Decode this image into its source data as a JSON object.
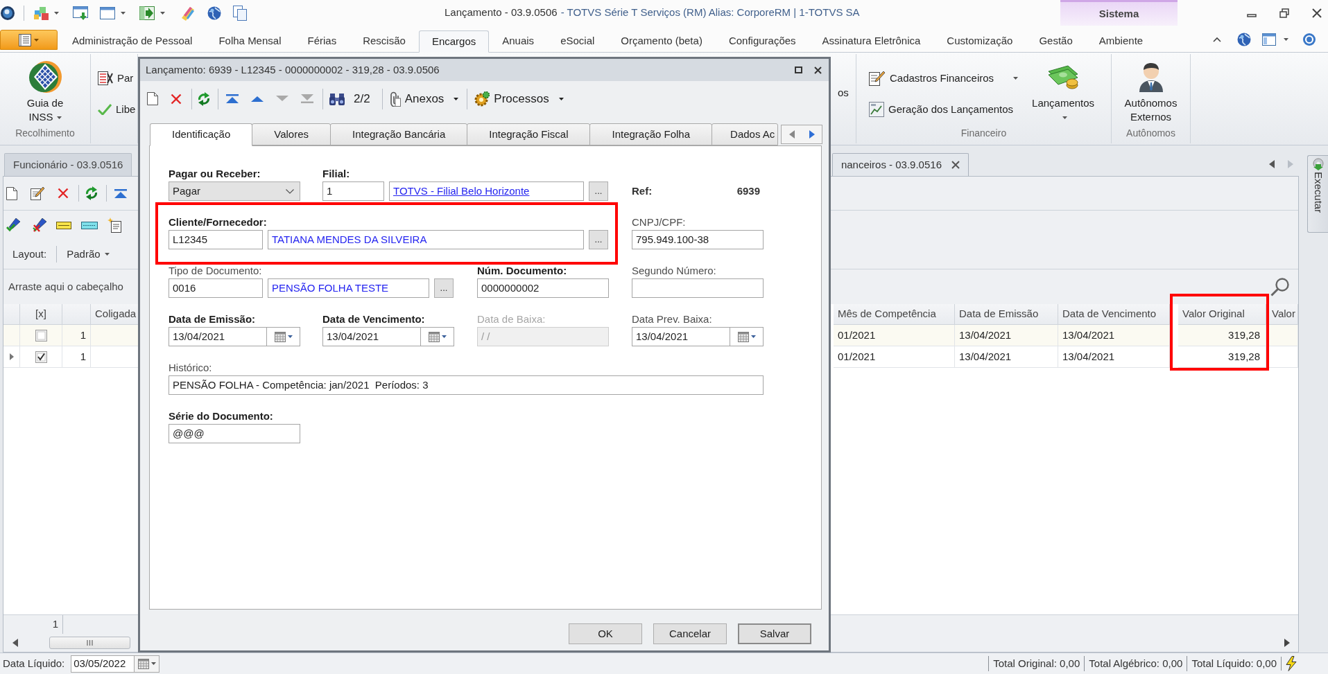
{
  "window": {
    "title": "Lançamento - 03.9.0506",
    "app_info": "- TOTVS Série T Serviços (RM) Alias: CorporeRM | 1-TOTVS SA",
    "context_tab": "Sistema"
  },
  "ribbon": {
    "tabs": [
      {
        "label": "Administração de Pessoal",
        "selected": false
      },
      {
        "label": "Folha Mensal",
        "selected": false
      },
      {
        "label": "Férias",
        "selected": false
      },
      {
        "label": "Rescisão",
        "selected": false
      },
      {
        "label": "Encargos",
        "selected": true
      },
      {
        "label": "Anuais",
        "selected": false
      },
      {
        "label": "eSocial",
        "selected": false
      },
      {
        "label": "Orçamento (beta)",
        "selected": false
      },
      {
        "label": "Configurações",
        "selected": false
      },
      {
        "label": "Assinatura Eletrônica",
        "selected": false
      },
      {
        "label": "Customização",
        "selected": false
      },
      {
        "label": "Gestão",
        "selected": false
      },
      {
        "label": "Ambiente",
        "selected": false
      }
    ],
    "groups_left": [
      {
        "label": "Recolhimento",
        "buttons": [
          {
            "kind": "large",
            "label": "Guia de INSS",
            "dropdown": true
          }
        ]
      },
      {
        "buttons": [
          {
            "kind": "small",
            "label": "Par"
          },
          {
            "kind": "small",
            "label": "Libe"
          }
        ]
      }
    ],
    "groups_right": [
      {
        "buttons": [
          {
            "kind": "fragment",
            "label": "os"
          }
        ]
      },
      {
        "label": "Financeiro",
        "buttons": [
          {
            "kind": "small",
            "label": "Cadastros Financeiros",
            "dropdown": true
          },
          {
            "kind": "small",
            "label": "Geração dos Lançamentos",
            "dropdown": false
          },
          {
            "kind": "large",
            "label": "Lançamentos",
            "dropdown": true
          }
        ]
      },
      {
        "label": "Autônomos",
        "buttons": [
          {
            "kind": "large",
            "label": "Autônomos Externos",
            "dropdown": false
          }
        ]
      }
    ]
  },
  "doc_tabs": [
    {
      "label": "Funcionário - 03.9.0516",
      "selected": false
    },
    {
      "label": "nanceiros - 03.9.0516",
      "selected": true
    }
  ],
  "list": {
    "layout_label": "Layout:",
    "layout_value": "Padrão",
    "group_hint": "Arraste aqui o cabeçalho",
    "columns_left": [
      {
        "label": "[x]"
      },
      {
        "label": "Coligada"
      }
    ],
    "columns_right": [
      {
        "label": "Mês de Competência",
        "kind": "text",
        "highlighted": false
      },
      {
        "label": "Data de Emissão",
        "kind": "text",
        "highlighted": false
      },
      {
        "label": "Data de Vencimento",
        "kind": "text",
        "highlighted": false
      },
      {
        "label": "Valor Original",
        "kind": "number",
        "highlighted": true
      },
      {
        "label": "Valor",
        "kind": "number",
        "highlighted": false
      }
    ],
    "rows": [
      {
        "selected": false,
        "checked": false,
        "column_3": "1",
        "cells": [
          "01/2021",
          "13/04/2021",
          "13/04/2021",
          "319,28"
        ]
      },
      {
        "selected": true,
        "checked": true,
        "column_3": "1",
        "cells": [
          "01/2021",
          "13/04/2021",
          "13/04/2021",
          "319,28"
        ]
      }
    ],
    "footer_count": "1"
  },
  "side_panel": {
    "label": "Executar"
  },
  "status_bar": {
    "label": "Data Líquido:",
    "value": "03/05/2022",
    "totals": [
      "Total Original: 0,00",
      "Total Algébrico: 0,00",
      "Total Líquido: 0,00"
    ]
  },
  "dialog": {
    "title": "Lançamento: 6939 - L12345 - 0000000002 - 319,28 - 03.9.0506",
    "toolbar": {
      "nav": [
        {
          "disabled": false
        },
        {
          "disabled": false
        },
        {
          "disabled": true
        },
        {
          "disabled": true
        }
      ],
      "counter": "2/2",
      "menus": [
        {
          "label": "Anexos"
        },
        {
          "label": "Processos"
        }
      ]
    },
    "tabs": [
      {
        "label": "Identificação",
        "selected": true
      },
      {
        "label": "Valores",
        "selected": false
      },
      {
        "label": "Integração Bancária",
        "selected": false
      },
      {
        "label": "Integração Fiscal",
        "selected": false
      },
      {
        "label": "Integração Folha",
        "selected": false
      },
      {
        "label": "Dados Ac",
        "selected": false
      }
    ],
    "form": [
      [
        {
          "kind": "select",
          "label": "Pagar ou Receber:",
          "required": true,
          "disabled": false,
          "highlighted": false,
          "value": "Pagar"
        },
        {
          "kind": "lookup",
          "label": "Filial:",
          "required": true,
          "disabled": false,
          "highlighted": false,
          "code": "1",
          "description": "TOTVS - Filial Belo Horizonte",
          "link": true,
          "button": "..."
        },
        {
          "kind": "readonly",
          "label": "Ref:",
          "value": "6939"
        }
      ],
      [
        {
          "kind": "lookup",
          "label": "Cliente/Fornecedor:",
          "required": true,
          "disabled": false,
          "highlighted": true,
          "code": "L12345",
          "description": "TATIANA MENDES DA SILVEIRA",
          "link": false,
          "button": "..."
        },
        {
          "kind": "text",
          "label": "CNPJ/CPF:",
          "required": false,
          "disabled": false,
          "highlighted": false,
          "value": "795.949.100-38"
        }
      ],
      [
        {
          "kind": "lookup",
          "label": "Tipo de Documento:",
          "required": false,
          "disabled": false,
          "highlighted": false,
          "code": "0016",
          "description": "PENSÃO FOLHA TESTE",
          "link": false,
          "button": "..."
        },
        {
          "kind": "text",
          "label": "Núm. Documento:",
          "required": true,
          "disabled": false,
          "highlighted": false,
          "value": "0000000002"
        },
        {
          "kind": "text",
          "label": "Segundo Número:",
          "required": false,
          "disabled": false,
          "highlighted": false
        }
      ],
      [
        {
          "kind": "date",
          "label": "Data de Emissão:",
          "required": true,
          "disabled": false,
          "highlighted": false,
          "value": "13/04/2021"
        },
        {
          "kind": "date",
          "label": "Data de Vencimento:",
          "required": true,
          "disabled": false,
          "highlighted": false,
          "value": "13/04/2021"
        },
        {
          "kind": "text",
          "label": "Data de Baixa:",
          "required": false,
          "disabled": true,
          "highlighted": false,
          "value": "/ /"
        },
        {
          "kind": "date",
          "label": "Data Prev. Baixa:",
          "required": false,
          "disabled": false,
          "highlighted": false,
          "value": "13/04/2021"
        }
      ],
      [
        {
          "kind": "memo",
          "label": "Histórico:",
          "required": false,
          "disabled": false,
          "highlighted": false,
          "value": "PENSÃO FOLHA - Competência: jan/2021  Períodos: 3"
        }
      ],
      [
        {
          "kind": "text",
          "label": "Série do Documento:",
          "required": true,
          "disabled": false,
          "highlighted": false,
          "value": "@@@"
        }
      ]
    ],
    "buttons": [
      {
        "label": "OK",
        "focused": false
      },
      {
        "label": "Cancelar",
        "focused": false
      },
      {
        "label": "Salvar",
        "focused": true
      }
    ]
  }
}
